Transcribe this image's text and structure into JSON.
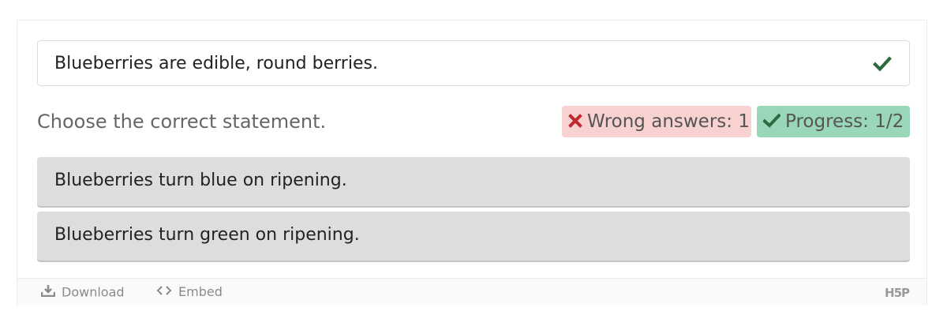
{
  "answered": {
    "text": "Blueberries are edible, round berries.",
    "status_icon": "check-icon",
    "status_color": "#2d6a3f"
  },
  "question": {
    "text": "Choose the correct statement."
  },
  "badges": {
    "wrong": {
      "label": "Wrong answers: 1",
      "icon": "x-icon",
      "icon_color": "#c0282d",
      "background": "#f8d1d1"
    },
    "progress": {
      "label": "Progress: 1/2",
      "value_fraction": 0.5,
      "icon": "check-icon",
      "icon_color": "#2d6a3f",
      "background": "#9ad7b9"
    }
  },
  "options": [
    {
      "text": "Blueberries turn blue on ripening."
    },
    {
      "text": "Blueberries turn green on ripening."
    }
  ],
  "footer": {
    "download_label": "Download",
    "embed_label": "Embed",
    "logo_text": "H5P"
  }
}
